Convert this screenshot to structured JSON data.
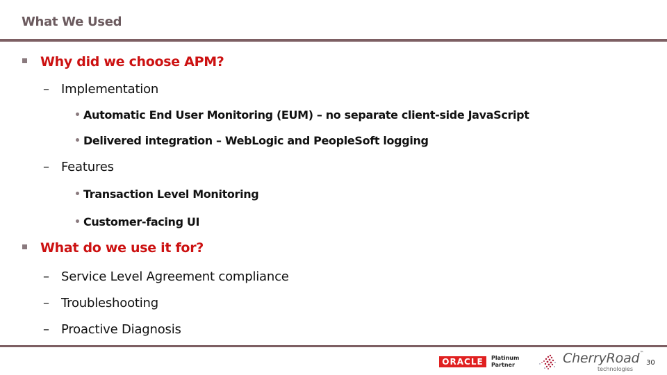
{
  "slide": {
    "title": "What We Used",
    "page_number": "30"
  },
  "content": {
    "sections": [
      {
        "heading": "Why did we choose APM?",
        "subsections": [
          {
            "label": "Implementation",
            "points": [
              "Automatic End User Monitoring (EUM) – no separate client-side JavaScript",
              "Delivered integration – WebLogic and PeopleSoft logging"
            ]
          },
          {
            "label": "Features",
            "points": [
              "Transaction Level Monitoring",
              "Customer-facing UI"
            ]
          }
        ]
      },
      {
        "heading": "What do we use it for?",
        "subsections": [
          {
            "label": "Service Level Agreement compliance"
          },
          {
            "label": "Troubleshooting"
          },
          {
            "label": "Proactive Diagnosis"
          }
        ]
      }
    ]
  },
  "footer": {
    "oracle_logo_text": "ORACLE",
    "partner_line1": "Platinum",
    "partner_line2": "Partner",
    "company_name": "CherryRoad",
    "company_tagline": "technologies"
  },
  "colors": {
    "title": "#6b5a5e",
    "rule": "#7d5f63",
    "heading_accent": "#cc1111",
    "oracle_red": "#e02020"
  }
}
